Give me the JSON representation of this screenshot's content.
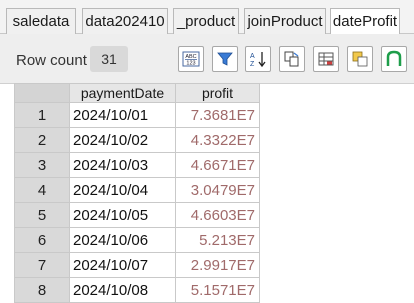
{
  "tabs": [
    {
      "label": "saledata"
    },
    {
      "label": "data202410"
    },
    {
      "label": "_product"
    },
    {
      "label": "joinProduct"
    },
    {
      "label": "dateProfit",
      "active": true
    }
  ],
  "toolbar": {
    "row_count_label": "Row count",
    "row_count_value": "31",
    "icons": [
      "abc-123-icon",
      "filter-icon",
      "sort-icon",
      "copy-icon",
      "table-icon",
      "highlight-icon",
      "chart-icon"
    ]
  },
  "grid": {
    "columns": [
      "paymentDate",
      "profit"
    ],
    "rows": [
      {
        "num": "1",
        "date": "2024/10/01",
        "profit": "7.3681E7"
      },
      {
        "num": "2",
        "date": "2024/10/02",
        "profit": "4.3322E7"
      },
      {
        "num": "3",
        "date": "2024/10/03",
        "profit": "4.6671E7"
      },
      {
        "num": "4",
        "date": "2024/10/04",
        "profit": "3.0479E7"
      },
      {
        "num": "5",
        "date": "2024/10/05",
        "profit": "4.6603E7"
      },
      {
        "num": "6",
        "date": "2024/10/06",
        "profit": "5.213E7"
      },
      {
        "num": "7",
        "date": "2024/10/07",
        "profit": "2.9917E7"
      },
      {
        "num": "8",
        "date": "2024/10/08",
        "profit": "5.1571E7"
      }
    ]
  },
  "colors": {
    "number_text": "#a06a6a",
    "header_bg": "#e6e6e6",
    "rownum_bg": "#d9d9d9"
  }
}
